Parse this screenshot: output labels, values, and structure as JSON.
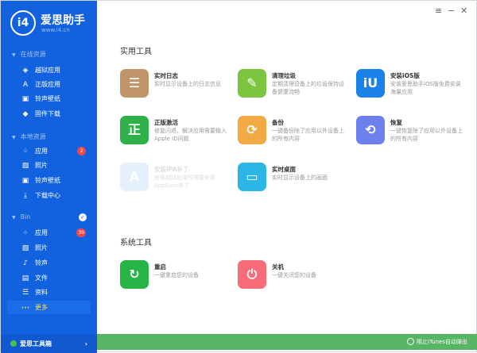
{
  "app": {
    "brand": "爱思助手",
    "url": "www.i4.cn",
    "logo": "i4"
  },
  "window": {
    "menu": "≡",
    "minimize": "−",
    "close": "✕"
  },
  "sidebar": {
    "groups": [
      {
        "title": "在线资源",
        "items": [
          {
            "label": "越狱应用",
            "icon": "box-icon"
          },
          {
            "label": "正版应用",
            "icon": "appstore-icon"
          },
          {
            "label": "铃声壁纸",
            "icon": "media-icon"
          },
          {
            "label": "固件下载",
            "icon": "cube-icon"
          }
        ]
      },
      {
        "title": "本地资源",
        "items": [
          {
            "label": "应用",
            "icon": "apps-icon",
            "badge": "2"
          },
          {
            "label": "照片",
            "icon": "photo-icon"
          },
          {
            "label": "铃声壁纸",
            "icon": "media-icon"
          },
          {
            "label": "下载中心",
            "icon": "download-icon"
          }
        ]
      },
      {
        "title": "Bin",
        "items": [
          {
            "label": "应用",
            "icon": "apps-icon",
            "badge": "39"
          },
          {
            "label": "照片",
            "icon": "photo-icon"
          },
          {
            "label": "铃声",
            "icon": "music-icon"
          },
          {
            "label": "文件",
            "icon": "file-icon"
          },
          {
            "label": "资料",
            "icon": "list-icon"
          },
          {
            "label": "更多",
            "icon": "more-icon",
            "active": true
          }
        ]
      }
    ],
    "toolbox": "爱思工具箱"
  },
  "main": {
    "sections": [
      {
        "title": "实用工具",
        "tools": [
          {
            "name": "实时日志",
            "desc": "实时显示设备上的日志信息",
            "color": "#c0956a",
            "glyph": "☰"
          },
          {
            "name": "清理垃圾",
            "desc": "定期清理设备上的垃圾保持设备健康流畅",
            "color": "#7cc540",
            "glyph": "✎"
          },
          {
            "name": "安装iOS版",
            "desc": "安装爱思助手iOS版免费安装海量应用",
            "color": "#1b82ea",
            "glyph": "iU"
          },
          {
            "name": "正版激活",
            "desc": "修复闪退，解决应用需要输入Apple ID问题",
            "color": "#2fb14a",
            "glyph": "正"
          },
          {
            "name": "备份",
            "desc": "一键备份除了应用以外设备上的所有内容",
            "color": "#f2aa45",
            "glyph": "⟳"
          },
          {
            "name": "恢复",
            "desc": "一键恢复除了应用以外设备上的所有内容",
            "color": "#6c80ee",
            "glyph": "⟲"
          },
          {
            "name": "安装IPA补丁",
            "desc": "安装越狱应用时需要安装AppSync补丁",
            "color": "#e6effc",
            "glyph": "A",
            "disabled": true
          },
          {
            "name": "实时桌面",
            "desc": "实时显示设备上的画面",
            "color": "#2bb6e6",
            "glyph": "▭"
          }
        ]
      },
      {
        "title": "系统工具",
        "tools": [
          {
            "name": "重启",
            "desc": "一键重启您的设备",
            "color": "#26b446",
            "glyph": "↻"
          },
          {
            "name": "关机",
            "desc": "一键关闭您的设备",
            "color": "#f86b78",
            "glyph": "⏻"
          }
        ]
      }
    ]
  },
  "footer": {
    "itunes": "阻止iTunes自动弹出"
  }
}
